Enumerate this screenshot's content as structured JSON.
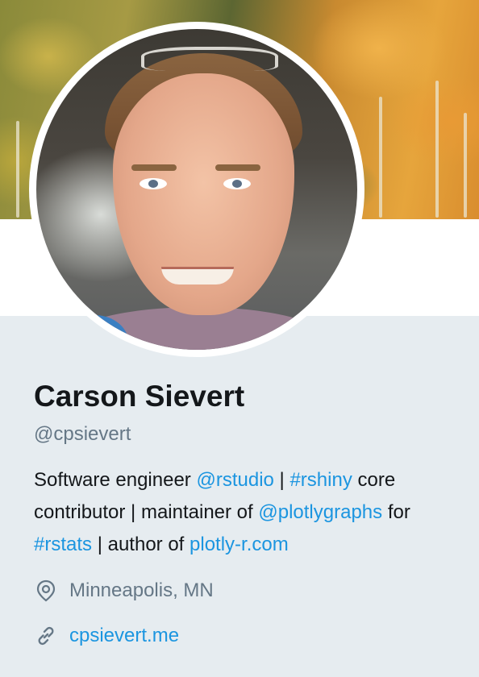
{
  "profile": {
    "name": "Carson Sievert",
    "handle": "@cpsievert",
    "bio": [
      {
        "text": "Software engineer ",
        "type": "text"
      },
      {
        "text": "@rstudio",
        "type": "mention"
      },
      {
        "text": " | ",
        "type": "text"
      },
      {
        "text": "#rshiny",
        "type": "hashtag"
      },
      {
        "text": " core contributor | maintainer of ",
        "type": "text"
      },
      {
        "text": "@plotlygraphs",
        "type": "mention"
      },
      {
        "text": " for ",
        "type": "text"
      },
      {
        "text": "#rstats",
        "type": "hashtag"
      },
      {
        "text": " | author of ",
        "type": "text"
      },
      {
        "text": "plotly-r.com",
        "type": "url"
      }
    ],
    "location": "Minneapolis, MN",
    "website": "cpsievert.me"
  },
  "icons": {
    "location": "map-pin-icon",
    "website": "link-icon"
  },
  "colors": {
    "link": "#1b95e0",
    "name": "#14171a",
    "secondary": "#657786",
    "background": "#e6ecf0"
  }
}
